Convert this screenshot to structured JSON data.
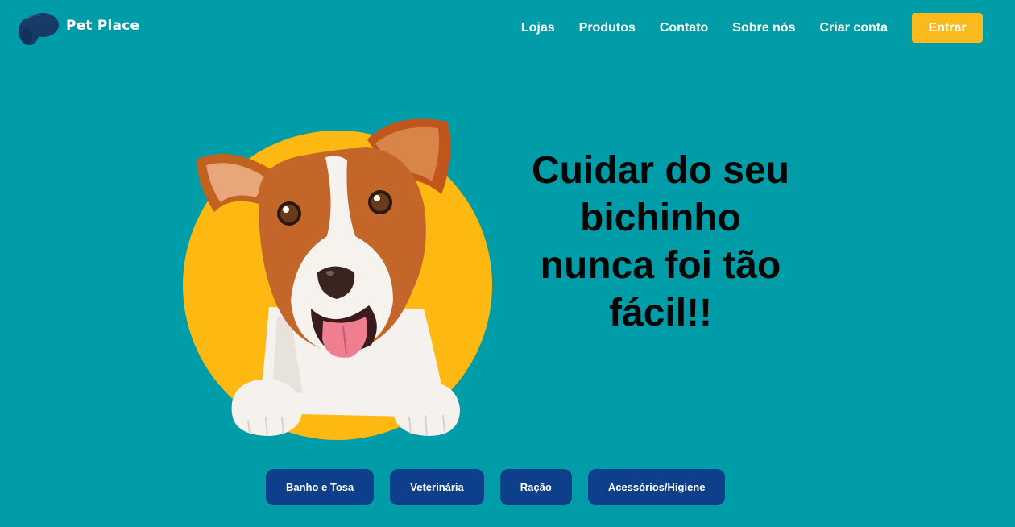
{
  "brand": {
    "name": "Pet Place",
    "logo_icon": "dog-head-icon"
  },
  "nav": {
    "links": [
      "Lojas",
      "Produtos",
      "Contato",
      "Sobre nós",
      "Criar conta"
    ],
    "login_label": "Entrar"
  },
  "hero": {
    "headline_lines": [
      "Cuidar do seu",
      "bichinho",
      "nunca foi tão",
      "fácil!!"
    ],
    "image": "dog-illustration"
  },
  "services": [
    "Banho e Tosa",
    "Veterinária",
    "Ração",
    "Acessórios/Higiene"
  ],
  "colors": {
    "background": "#009ca7",
    "accent": "#fbba1c",
    "button": "#0e3f8a",
    "text_light": "#ffffff",
    "headline": "#050505",
    "logo_dark": "#173a66"
  }
}
